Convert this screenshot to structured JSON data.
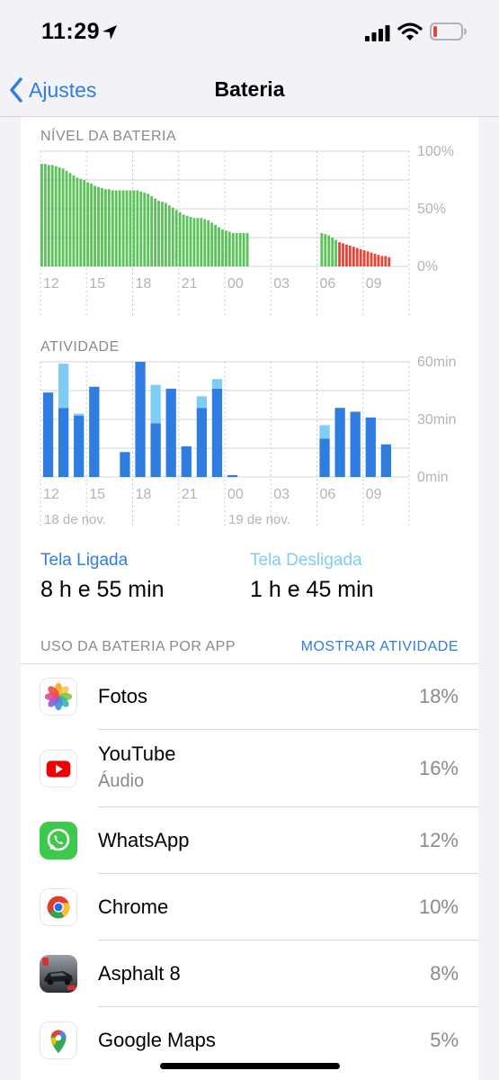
{
  "status_bar": {
    "time": "11:29"
  },
  "nav": {
    "back_label": "Ajustes",
    "title": "Bateria"
  },
  "battery_level": {
    "label": "NÍVEL DA BATERIA",
    "y_ticks": [
      "100%",
      "50%",
      "0%"
    ],
    "x_ticks": [
      "12",
      "15",
      "18",
      "21",
      "00",
      "03",
      "06",
      "09"
    ]
  },
  "activity": {
    "label": "ATIVIDADE",
    "y_ticks": [
      "60min",
      "30min",
      "0min"
    ],
    "x_ticks": [
      "12",
      "15",
      "18",
      "21",
      "00",
      "03",
      "06",
      "09"
    ],
    "date_labels": [
      "18 de nov.",
      "19 de nov."
    ]
  },
  "chart_data": [
    {
      "type": "bar",
      "title": "NÍVEL DA BATERIA",
      "x_ticks": [
        "12",
        "15",
        "18",
        "21",
        "00",
        "03",
        "06",
        "09"
      ],
      "ylim": [
        0,
        100
      ],
      "y_ticks": [
        "100%",
        "50%",
        "0%"
      ],
      "series": [
        {
          "values": [
            89,
            89,
            88,
            88,
            87,
            86,
            85,
            83,
            81,
            79,
            77,
            76,
            75,
            73,
            72,
            70,
            69,
            68,
            67,
            67,
            66,
            66,
            66,
            66,
            66,
            66,
            66,
            66,
            65,
            64,
            63,
            61,
            59,
            57,
            56,
            55,
            53,
            51,
            49,
            47,
            45,
            44,
            43,
            42,
            42,
            42,
            41,
            40,
            38,
            36,
            34,
            32,
            31,
            30,
            29,
            29,
            29,
            29,
            29,
            null,
            null,
            null,
            null,
            null,
            null,
            null,
            null,
            null,
            null,
            null,
            null,
            null,
            null,
            null,
            null,
            null,
            null,
            null,
            null,
            29,
            28,
            27,
            25,
            23,
            21,
            20,
            19,
            18,
            17,
            16,
            15,
            14,
            13,
            12,
            11,
            10,
            9,
            9,
            8
          ],
          "low_threshold_start_index": 84,
          "colors": {
            "normal": "#5cc25a",
            "low": "#e0483b"
          }
        }
      ]
    },
    {
      "type": "bar",
      "title": "ATIVIDADE",
      "categories": [
        "12",
        "13",
        "14",
        "15",
        "16",
        "17",
        "18",
        "19",
        "20",
        "21",
        "22",
        "23",
        "00",
        "01",
        "02",
        "03",
        "04",
        "05",
        "06",
        "07",
        "08",
        "09",
        "10"
      ],
      "x_ticks": [
        "12",
        "15",
        "18",
        "21",
        "00",
        "03",
        "06",
        "09"
      ],
      "ylim": [
        0,
        60
      ],
      "y_ticks": [
        "60min",
        "30min",
        "0min"
      ],
      "stacked": true,
      "series": [
        {
          "name": "Tela Ligada",
          "color": "#2f7de1",
          "values": [
            44,
            36,
            32,
            47,
            0,
            13,
            60,
            28,
            46,
            16,
            36,
            46,
            1,
            0,
            0,
            0,
            0,
            0,
            20,
            36,
            34,
            31,
            17
          ]
        },
        {
          "name": "Tela Desligada",
          "color": "#7fcdf5",
          "values": [
            0,
            23,
            1,
            0,
            0,
            0,
            0,
            20,
            0,
            0,
            6,
            5,
            0,
            0,
            0,
            0,
            0,
            0,
            7,
            0,
            0,
            0,
            0
          ]
        }
      ]
    }
  ],
  "summary": {
    "on_label": "Tela Ligada",
    "on_value": "8 h e 55 min",
    "off_label": "Tela Desligada",
    "off_value": "1 h e 45 min"
  },
  "app_usage": {
    "label": "USO DA BATERIA POR APP",
    "action": "MOSTRAR ATIVIDADE",
    "apps": [
      {
        "name": "Fotos",
        "pct": "18%",
        "icon": "photos-icon"
      },
      {
        "name": "YouTube",
        "sub": "Áudio",
        "pct": "16%",
        "icon": "youtube-icon"
      },
      {
        "name": "WhatsApp",
        "pct": "12%",
        "icon": "whatsapp-icon"
      },
      {
        "name": "Chrome",
        "pct": "10%",
        "icon": "chrome-icon"
      },
      {
        "name": "Asphalt 8",
        "pct": "8%",
        "icon": "asphalt-icon"
      },
      {
        "name": "Google Maps",
        "pct": "5%",
        "icon": "google-maps-icon"
      }
    ]
  },
  "colors": {
    "accent": "#2f7de1",
    "screen_off": "#7fcdf5",
    "battery_green": "#5cc25a",
    "battery_red": "#e0483b"
  }
}
